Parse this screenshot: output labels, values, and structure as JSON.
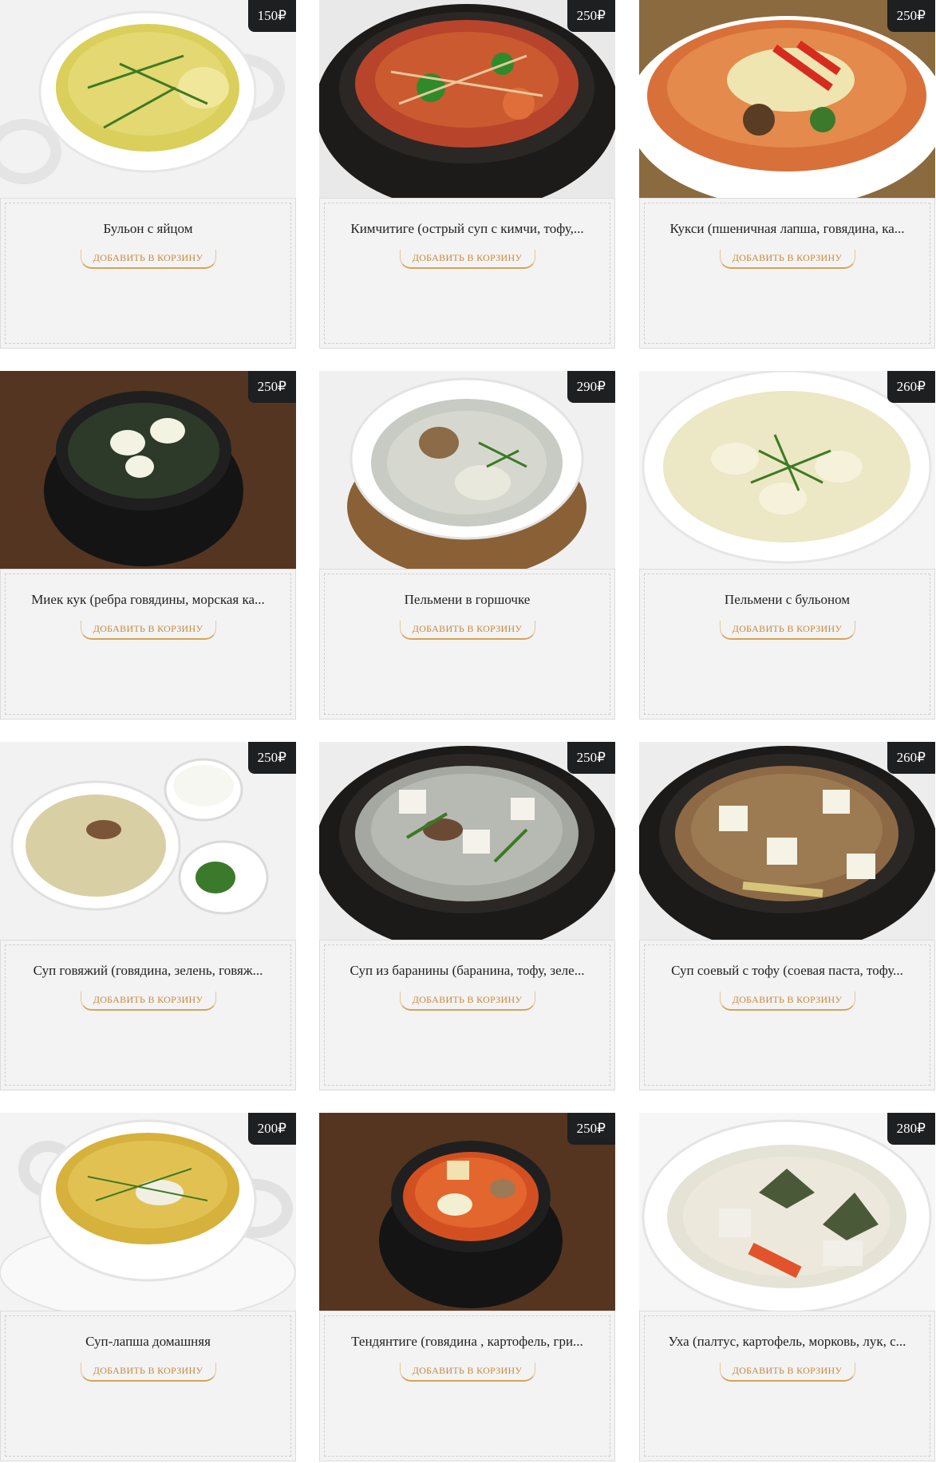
{
  "cart_button_label": "ДОБАВИТЬ В КОРЗИНУ",
  "currency": "₽",
  "products": [
    {
      "name": "Бульон с яйцом",
      "price": "150₽"
    },
    {
      "name": "Кимчитиге (острый суп с кимчи, тофу,...",
      "price": "250₽"
    },
    {
      "name": "Кукси (пшеничная лапша, говядина, ка...",
      "price": "250₽"
    },
    {
      "name": "Миек кук (ребра говядины, морская ка...",
      "price": "250₽"
    },
    {
      "name": "Пельмени в горшочке",
      "price": "290₽"
    },
    {
      "name": "Пельмени с бульоном",
      "price": "260₽"
    },
    {
      "name": "Суп говяжий (говядина, зелень, говяж...",
      "price": "250₽"
    },
    {
      "name": "Суп из баранины (баранина, тофу, зеле...",
      "price": "250₽"
    },
    {
      "name": "Суп соевый с тофу (соевая паста, тофу...",
      "price": "260₽"
    },
    {
      "name": "Суп-лапша домашняя",
      "price": "200₽"
    },
    {
      "name": "Тендянтиге (говядина , картофель, гри...",
      "price": "250₽"
    },
    {
      "name": "Уха (палтус, картофель, морковь, лук, с...",
      "price": "280₽"
    }
  ]
}
